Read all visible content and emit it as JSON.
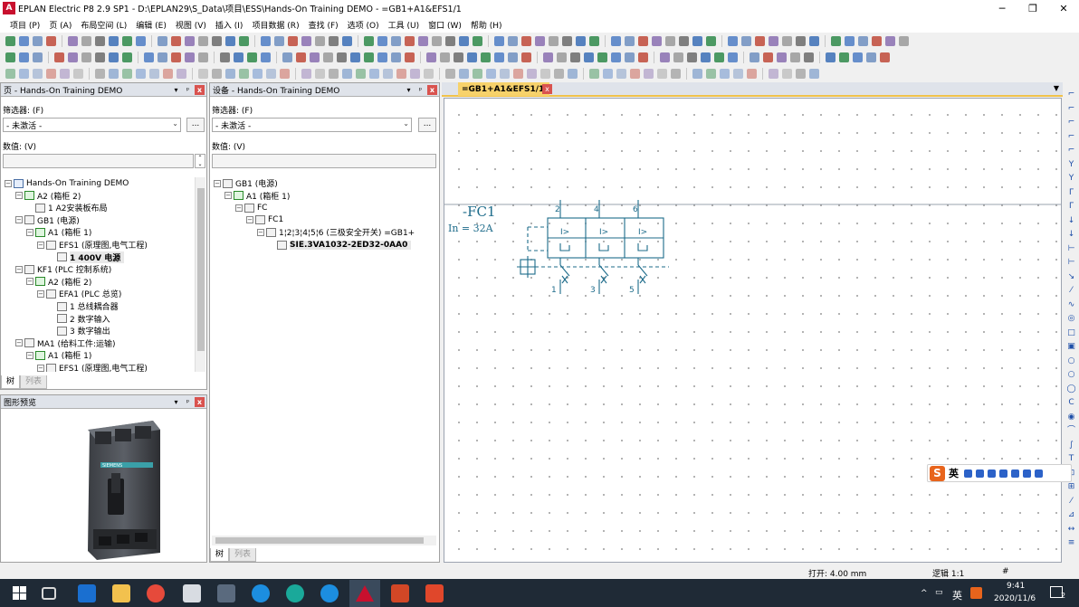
{
  "window": {
    "logo": "A",
    "title": "EPLAN Electric P8 2.9 SP1 - D:\\EPLAN29\\S_Data\\项目\\ESS\\Hands-On Training DEMO - =GB1+A1&EFS1/1",
    "minimize": "─",
    "maximize": "❐",
    "close": "✕"
  },
  "menu": [
    "项目 (P)",
    "页 (A)",
    "布局空间 (L)",
    "编辑 (E)",
    "视图 (V)",
    "插入 (I)",
    "项目数据 (R)",
    "查找 (F)",
    "选项 (O)",
    "工具 (U)",
    "窗口 (W)",
    "帮助 (H)"
  ],
  "page_panel": {
    "title": "页 - Hands-On Training DEMO",
    "pin": "▾",
    "pin2": "ᵖ",
    "close": "x",
    "filter_label": "筛选器: (F)",
    "filter_value": "- 未激活 -",
    "more": "...",
    "value_label": "数值: (V)",
    "tree": [
      {
        "d": 0,
        "exp": "−",
        "icon": "proj",
        "t": "Hands-On Training DEMO"
      },
      {
        "d": 1,
        "exp": "−",
        "icon": "green",
        "t": "A2 (箱柜 2)"
      },
      {
        "d": 2,
        "exp": "",
        "icon": "page",
        "t": "1 A2安装板布局"
      },
      {
        "d": 1,
        "exp": "−",
        "icon": "page",
        "t": "GB1 (电源)"
      },
      {
        "d": 2,
        "exp": "−",
        "icon": "green",
        "t": "A1 (箱柜 1)"
      },
      {
        "d": 3,
        "exp": "−",
        "icon": "page",
        "t": "EFS1 (原理图,电气工程)"
      },
      {
        "d": 4,
        "exp": "",
        "icon": "page",
        "t": "1 400V 电源",
        "sel": true
      },
      {
        "d": 1,
        "exp": "−",
        "icon": "page",
        "t": "KF1 (PLC 控制系统)"
      },
      {
        "d": 2,
        "exp": "−",
        "icon": "green",
        "t": "A2 (箱柜 2)"
      },
      {
        "d": 3,
        "exp": "−",
        "icon": "page",
        "t": "EFA1 (PLC 总览)"
      },
      {
        "d": 4,
        "exp": "",
        "icon": "page",
        "t": "1 总线耦合器"
      },
      {
        "d": 4,
        "exp": "",
        "icon": "page",
        "t": "2 数字输入"
      },
      {
        "d": 4,
        "exp": "",
        "icon": "page",
        "t": "3 数字输出"
      },
      {
        "d": 1,
        "exp": "−",
        "icon": "page",
        "t": "MA1 (给料工件:运输)"
      },
      {
        "d": 2,
        "exp": "−",
        "icon": "green",
        "t": "A1 (箱柜 1)"
      },
      {
        "d": 3,
        "exp": "−",
        "icon": "page",
        "t": "EFS1 (原理图,电气工程)"
      }
    ],
    "tab_tree": "树",
    "tab_list": "列表"
  },
  "preview_panel": {
    "title": "图形预览",
    "pin": "▾",
    "pin2": "ᵖ",
    "close": "x",
    "brand": "SIEMENS"
  },
  "device_panel": {
    "title": "设备 - Hands-On Training DEMO",
    "pin": "▾",
    "pin2": "ᵖ",
    "close": "x",
    "filter_label": "筛选器: (F)",
    "filter_value": "- 未激活 -",
    "more": "...",
    "value_label": "数值: (V)",
    "tree": [
      {
        "d": 0,
        "exp": "−",
        "icon": "page",
        "t": "GB1 (电源)"
      },
      {
        "d": 1,
        "exp": "−",
        "icon": "green",
        "t": "A1 (箱柜 1)"
      },
      {
        "d": 2,
        "exp": "−",
        "icon": "page",
        "t": "FC"
      },
      {
        "d": 3,
        "exp": "−",
        "icon": "page",
        "t": "FC1"
      },
      {
        "d": 4,
        "exp": "−",
        "icon": "page",
        "t": "1¦2¦3¦4¦5¦6 (三极安全开关) =GB1+"
      },
      {
        "d": 5,
        "exp": "",
        "icon": "page",
        "t": "SIE.3VA1032-2ED32-0AA0",
        "sel": true
      }
    ],
    "tab_tree": "树",
    "tab_list": "列表"
  },
  "document_tab": {
    "label": "=GB1+A1&EFS1/1",
    "close": "x",
    "menu": "▼"
  },
  "schematic": {
    "device_tag": "-FC1",
    "rating": "In = 32A",
    "terminals_top": [
      "2",
      "4",
      "6"
    ],
    "terminals_bottom": [
      "1",
      "3",
      "5"
    ],
    "trip_label": "I>"
  },
  "ime": {
    "logo": "S",
    "lang": "英"
  },
  "status": {
    "grid": "打开: 4.00 mm",
    "logic": "逻辑 1:1",
    "hash": "#"
  },
  "taskbar": {
    "time": "9:41",
    "date": "2020/11/6",
    "lang": "英",
    "notify_count": "2",
    "tray_arrow": "^",
    "tray_net": "▭",
    "tray_vol": "◖"
  },
  "colors": {
    "accent": "#f7d26b",
    "schematic": "#1d6b8a",
    "eplan_red": "#c8102e",
    "panel_header": "#dfe3ea"
  }
}
